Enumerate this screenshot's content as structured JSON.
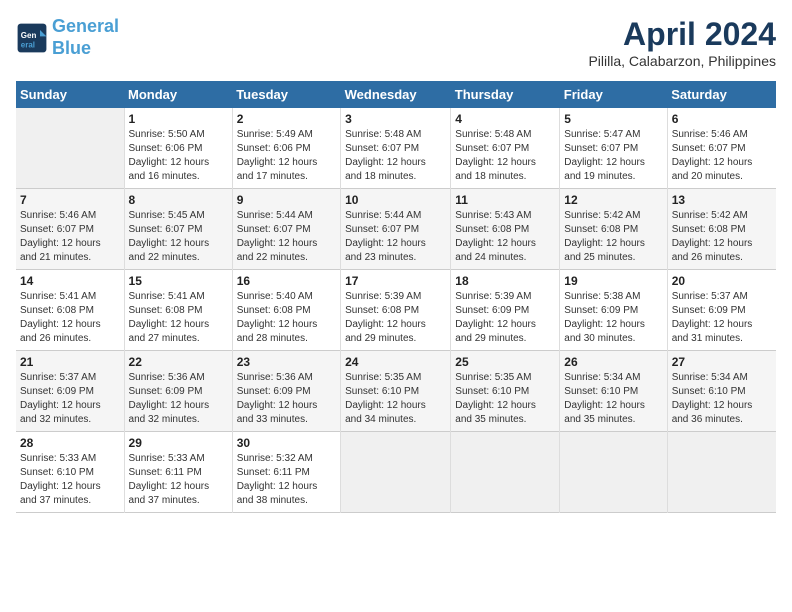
{
  "header": {
    "logo_line1": "General",
    "logo_line2": "Blue",
    "month": "April 2024",
    "location": "Pililla, Calabarzon, Philippines"
  },
  "weekdays": [
    "Sunday",
    "Monday",
    "Tuesday",
    "Wednesday",
    "Thursday",
    "Friday",
    "Saturday"
  ],
  "weeks": [
    [
      {
        "day": "",
        "info": ""
      },
      {
        "day": "1",
        "info": "Sunrise: 5:50 AM\nSunset: 6:06 PM\nDaylight: 12 hours\nand 16 minutes."
      },
      {
        "day": "2",
        "info": "Sunrise: 5:49 AM\nSunset: 6:06 PM\nDaylight: 12 hours\nand 17 minutes."
      },
      {
        "day": "3",
        "info": "Sunrise: 5:48 AM\nSunset: 6:07 PM\nDaylight: 12 hours\nand 18 minutes."
      },
      {
        "day": "4",
        "info": "Sunrise: 5:48 AM\nSunset: 6:07 PM\nDaylight: 12 hours\nand 18 minutes."
      },
      {
        "day": "5",
        "info": "Sunrise: 5:47 AM\nSunset: 6:07 PM\nDaylight: 12 hours\nand 19 minutes."
      },
      {
        "day": "6",
        "info": "Sunrise: 5:46 AM\nSunset: 6:07 PM\nDaylight: 12 hours\nand 20 minutes."
      }
    ],
    [
      {
        "day": "7",
        "info": "Sunrise: 5:46 AM\nSunset: 6:07 PM\nDaylight: 12 hours\nand 21 minutes."
      },
      {
        "day": "8",
        "info": "Sunrise: 5:45 AM\nSunset: 6:07 PM\nDaylight: 12 hours\nand 22 minutes."
      },
      {
        "day": "9",
        "info": "Sunrise: 5:44 AM\nSunset: 6:07 PM\nDaylight: 12 hours\nand 22 minutes."
      },
      {
        "day": "10",
        "info": "Sunrise: 5:44 AM\nSunset: 6:07 PM\nDaylight: 12 hours\nand 23 minutes."
      },
      {
        "day": "11",
        "info": "Sunrise: 5:43 AM\nSunset: 6:08 PM\nDaylight: 12 hours\nand 24 minutes."
      },
      {
        "day": "12",
        "info": "Sunrise: 5:42 AM\nSunset: 6:08 PM\nDaylight: 12 hours\nand 25 minutes."
      },
      {
        "day": "13",
        "info": "Sunrise: 5:42 AM\nSunset: 6:08 PM\nDaylight: 12 hours\nand 26 minutes."
      }
    ],
    [
      {
        "day": "14",
        "info": "Sunrise: 5:41 AM\nSunset: 6:08 PM\nDaylight: 12 hours\nand 26 minutes."
      },
      {
        "day": "15",
        "info": "Sunrise: 5:41 AM\nSunset: 6:08 PM\nDaylight: 12 hours\nand 27 minutes."
      },
      {
        "day": "16",
        "info": "Sunrise: 5:40 AM\nSunset: 6:08 PM\nDaylight: 12 hours\nand 28 minutes."
      },
      {
        "day": "17",
        "info": "Sunrise: 5:39 AM\nSunset: 6:08 PM\nDaylight: 12 hours\nand 29 minutes."
      },
      {
        "day": "18",
        "info": "Sunrise: 5:39 AM\nSunset: 6:09 PM\nDaylight: 12 hours\nand 29 minutes."
      },
      {
        "day": "19",
        "info": "Sunrise: 5:38 AM\nSunset: 6:09 PM\nDaylight: 12 hours\nand 30 minutes."
      },
      {
        "day": "20",
        "info": "Sunrise: 5:37 AM\nSunset: 6:09 PM\nDaylight: 12 hours\nand 31 minutes."
      }
    ],
    [
      {
        "day": "21",
        "info": "Sunrise: 5:37 AM\nSunset: 6:09 PM\nDaylight: 12 hours\nand 32 minutes."
      },
      {
        "day": "22",
        "info": "Sunrise: 5:36 AM\nSunset: 6:09 PM\nDaylight: 12 hours\nand 32 minutes."
      },
      {
        "day": "23",
        "info": "Sunrise: 5:36 AM\nSunset: 6:09 PM\nDaylight: 12 hours\nand 33 minutes."
      },
      {
        "day": "24",
        "info": "Sunrise: 5:35 AM\nSunset: 6:10 PM\nDaylight: 12 hours\nand 34 minutes."
      },
      {
        "day": "25",
        "info": "Sunrise: 5:35 AM\nSunset: 6:10 PM\nDaylight: 12 hours\nand 35 minutes."
      },
      {
        "day": "26",
        "info": "Sunrise: 5:34 AM\nSunset: 6:10 PM\nDaylight: 12 hours\nand 35 minutes."
      },
      {
        "day": "27",
        "info": "Sunrise: 5:34 AM\nSunset: 6:10 PM\nDaylight: 12 hours\nand 36 minutes."
      }
    ],
    [
      {
        "day": "28",
        "info": "Sunrise: 5:33 AM\nSunset: 6:10 PM\nDaylight: 12 hours\nand 37 minutes."
      },
      {
        "day": "29",
        "info": "Sunrise: 5:33 AM\nSunset: 6:11 PM\nDaylight: 12 hours\nand 37 minutes."
      },
      {
        "day": "30",
        "info": "Sunrise: 5:32 AM\nSunset: 6:11 PM\nDaylight: 12 hours\nand 38 minutes."
      },
      {
        "day": "",
        "info": ""
      },
      {
        "day": "",
        "info": ""
      },
      {
        "day": "",
        "info": ""
      },
      {
        "day": "",
        "info": ""
      }
    ]
  ]
}
